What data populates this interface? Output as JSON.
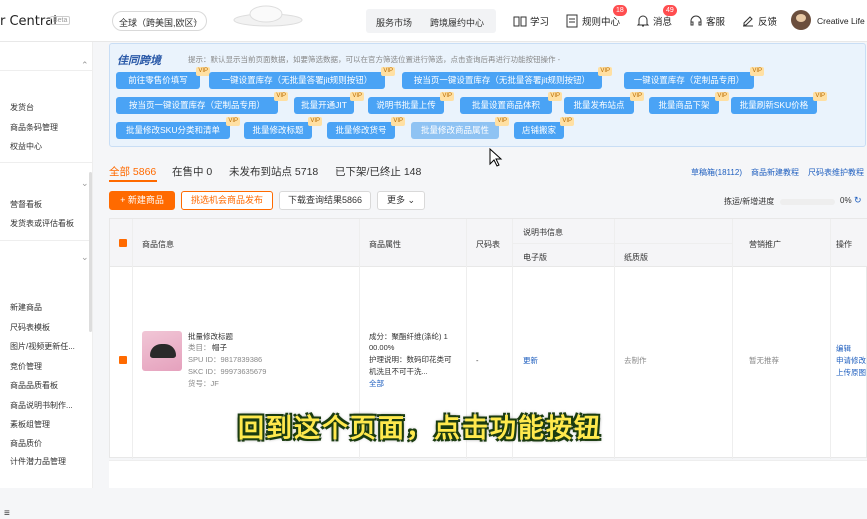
{
  "header": {
    "brand": "r Central",
    "beta": "Beta",
    "site_selector": "全球（跨美国,欧区）",
    "nav_box": [
      "服务市场",
      "跨境履约中心"
    ],
    "items": [
      {
        "label": "学习",
        "icon": "book-icon"
      },
      {
        "label": "规则中心",
        "icon": "rules-icon",
        "badge": "18"
      },
      {
        "label": "消息",
        "icon": "bell-icon",
        "badge": "49"
      },
      {
        "label": "客服",
        "icon": "headset-icon"
      },
      {
        "label": "反馈",
        "icon": "edit-icon"
      }
    ],
    "user": "Creative Life"
  },
  "sidebar": {
    "items": [
      "发货台",
      "商品条码管理",
      "权益中心",
      "营督看板",
      "发货表或评估看板",
      "新建商品",
      "尺码表模板",
      "图片/视频更新任...",
      "竞价管理",
      "商品品质看板",
      "商品说明书制作...",
      "素板组管理",
      "商品质价",
      "计件潜力品管理"
    ]
  },
  "banner": {
    "logo": "佳同跨境",
    "tip": "提示：默认显示当前页面数据，如要筛选数据，可以在官方筛选位置进行筛选，点击查询后再进行功能按钮操作 -",
    "vip": "VIP",
    "row1": [
      "前往零售价填写",
      "一键设置库存（无批量答署jit规则按钮）",
      "按当页一键设置库存（无批量答署jit规则按钮）",
      "一键设置库存（定制品专用）"
    ],
    "row2": [
      "按当页一键设置库存（定制品专用）",
      "批量开通JIT",
      "说明书批量上传",
      "批量设置商品体积",
      "批量发布站点",
      "批量商品下架",
      "批量刷新SKU价格"
    ],
    "row3": [
      "批量修改SKU分类和清单",
      "批量修改标题",
      "批量修改货号",
      "批量修改商品属性",
      "店铺搬家"
    ]
  },
  "tabs": [
    "全部 5866",
    "在售中 0",
    "未发布到站点 5718",
    "已下架/已终止 148"
  ],
  "links": [
    "草稿箱(18112)",
    "商品新建教程",
    "尺码表维护教程"
  ],
  "actions": {
    "new_product": "+ 新建商品",
    "pick": "挑选机会商品发布",
    "download": "下载查询结果5866",
    "more": "更多 ⌄"
  },
  "progress": {
    "label": "拣运/新增进度",
    "value": "0%",
    "fraction": 0.0
  },
  "table": {
    "headers": {
      "product": "商品信息",
      "attr": "商品属性",
      "size": "尺码表",
      "manual": "说明书信息",
      "manual_e": "电子版",
      "manual_p": "纸质版",
      "marketing": "营销推广",
      "ops": "操作"
    },
    "row": {
      "title": "批量修改标题",
      "category_label": "类目：",
      "category": "帽子",
      "spu": "SPU ID：9817839386",
      "skc": "SKC ID：99973635679",
      "sku_no": "货号：JF",
      "attr_line1": "成分：聚酯纤维(涤纶) 1",
      "attr_line2": "00.00%",
      "attr_line3": "护理说明：数码印花类可",
      "attr_line4": "机洗且不可干洗...",
      "attr_all": "全部",
      "size": "-",
      "manual_e": "更新",
      "manual_p": "去制作",
      "marketing": "暂无推荐",
      "op1": "编辑",
      "op2": "申请修改",
      "op3": "上传原图"
    }
  },
  "subtitle": "回到这个页面，点击功能按钮",
  "colors": {
    "accent": "#ff6a00",
    "blue_btn": "#4aa3f5",
    "link": "#1f5fbf"
  }
}
